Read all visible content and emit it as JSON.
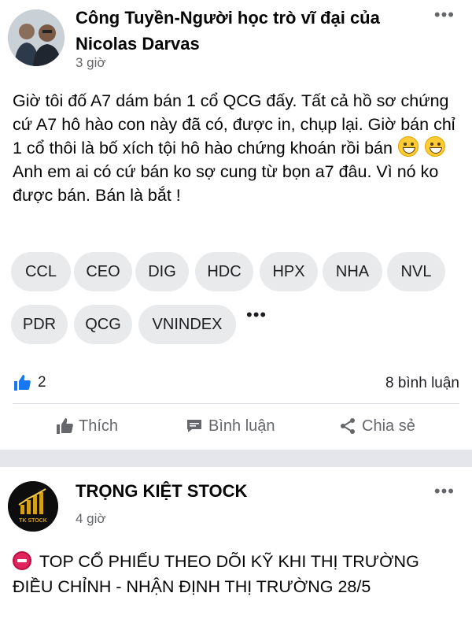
{
  "post1": {
    "author": "Công Tuyền-Người học trò vĩ đại của Nicolas Darvas",
    "time": "3 giờ",
    "more": "•••",
    "text_part1": "Giờ tôi đố A7 dám bán 1 cổ QCG đấy. Tất cả hồ sơ chứng cứ A7 hô hào con này đã có, được in, chụp lại. Giờ bán chỉ 1 cổ thôi là bố xích tội hô hào chứng khoán rồi bán ",
    "text_part2": "Anh em ai có cứ bán ko sợ cung từ bọn a7 đâu. Vì nó ko được bán. Bán là bắt !",
    "tags": [
      "CCL",
      "CEO",
      "DIG",
      "HDC",
      "HPX",
      "NHA",
      "NVL",
      "PDR",
      "QCG",
      "VNINDEX"
    ],
    "tags_more": "•••",
    "like_count": "2",
    "comment_count": "8 bình luận",
    "actions": {
      "like": "Thích",
      "comment": "Bình luận",
      "share": "Chia sẻ"
    }
  },
  "post2": {
    "author": "TRỌNG KIỆT STOCK",
    "avatar_text": "TK STOCK",
    "time": "4 giờ",
    "more": "•••",
    "text": "TOP CỔ PHIẾU THEO DÕI KỸ KHI THỊ TRƯỜNG ĐIỀU CHỈNH - NHẬN ĐỊNH THỊ TRƯỜNG 28/5"
  },
  "colors": {
    "accent": "#1877f2",
    "muted": "#65676b",
    "tag_bg": "#e9eaec",
    "separator": "#e4e6eb"
  }
}
